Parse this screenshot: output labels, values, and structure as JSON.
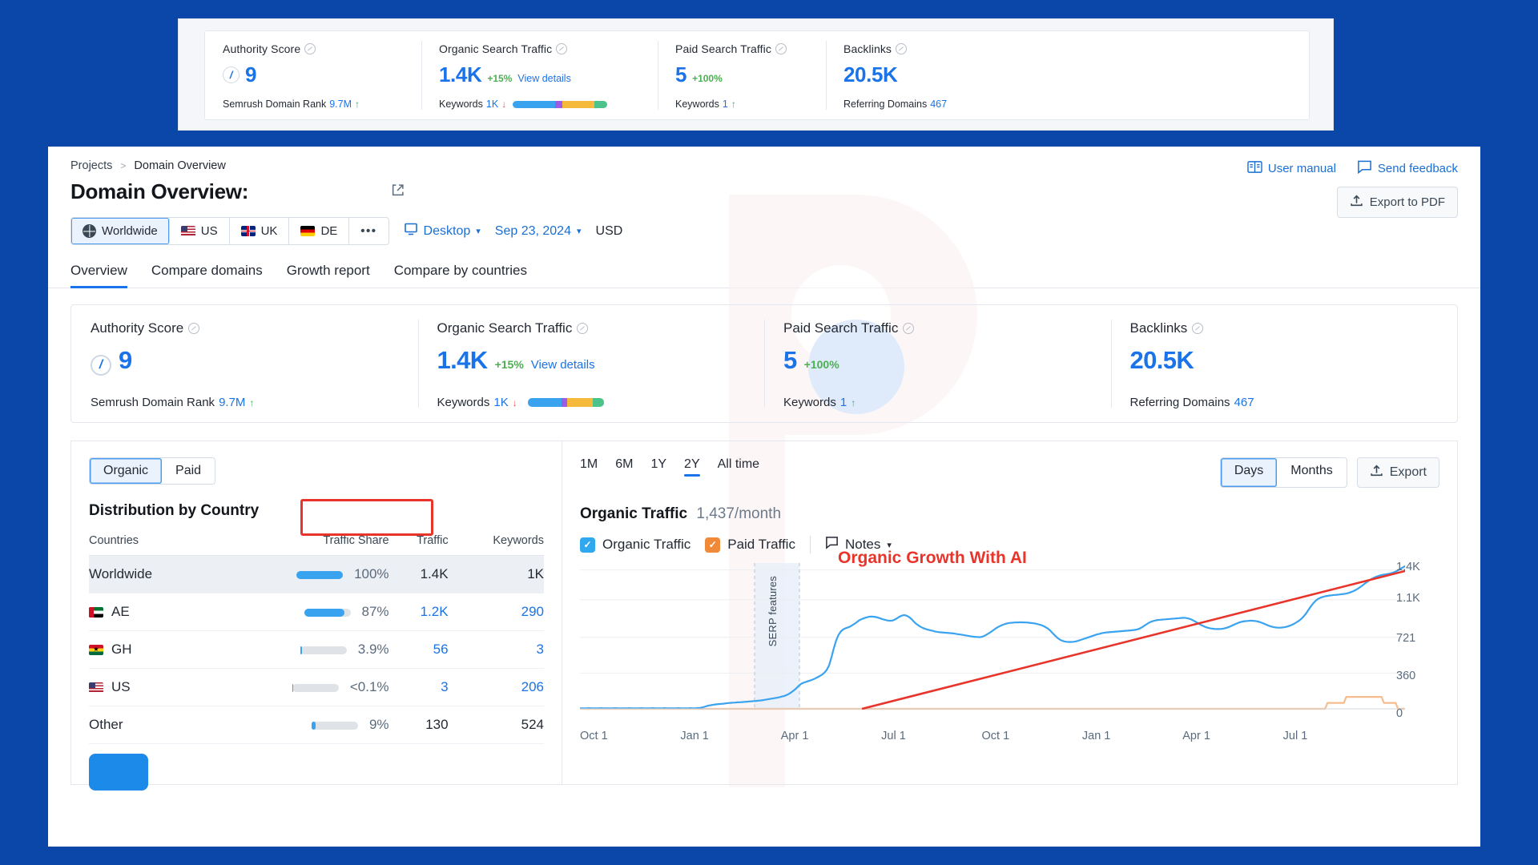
{
  "top_card": {
    "cells": [
      {
        "label": "Authority Score",
        "info_icon": "info-icon",
        "score": "9",
        "score_ring_icon": "authority-ring-icon",
        "sub_label": "Semrush Domain Rank",
        "sub_value": "9.7M",
        "trend": "↑",
        "trend_dir": "up"
      },
      {
        "label": "Organic Search Traffic",
        "info_icon": "info-icon",
        "value": "1.4K",
        "delta": "+15%",
        "link": "View details",
        "sub_label": "Keywords",
        "sub_value": "1K",
        "trend": "↓",
        "trend_dir": "down"
      },
      {
        "label": "Paid Search Traffic",
        "info_icon": "info-icon",
        "value": "5",
        "delta": "+100%",
        "sub_label": "Keywords",
        "sub_value": "1",
        "trend": "↑",
        "trend_dir": "up"
      },
      {
        "label": "Backlinks",
        "info_icon": "info-icon",
        "value": "20.5K",
        "sub_label": "Referring Domains",
        "sub_value": "467"
      }
    ]
  },
  "header": {
    "breadcrumb": {
      "root": "Projects",
      "separator": ">",
      "current": "Domain Overview"
    },
    "title_prefix": "Domain Overview:",
    "external_link_icon": "external-link-icon",
    "user_manual": "User manual",
    "user_manual_icon": "book-icon",
    "send_feedback": "Send feedback",
    "send_feedback_icon": "speech-bubble-icon",
    "export_pdf": "Export to PDF",
    "export_pdf_icon": "upload-icon"
  },
  "filters": {
    "geos": [
      {
        "label": "Worldwide",
        "icon": "globe-icon",
        "active": true
      },
      {
        "label": "US",
        "icon": "flag-us-icon",
        "active": false
      },
      {
        "label": "UK",
        "icon": "flag-uk-icon",
        "active": false
      },
      {
        "label": "DE",
        "icon": "flag-de-icon",
        "active": false
      },
      {
        "label": "•••",
        "icon": "more-icon",
        "active": false
      }
    ],
    "device": "Desktop",
    "device_icon": "monitor-icon",
    "date": "Sep 23, 2024",
    "currency": "USD"
  },
  "tabs": [
    {
      "label": "Overview",
      "active": true
    },
    {
      "label": "Compare domains",
      "active": false
    },
    {
      "label": "Growth report",
      "active": false
    },
    {
      "label": "Compare by countries",
      "active": false
    }
  ],
  "metrics": [
    {
      "label": "Authority Score",
      "info_icon": "info-icon",
      "score": "9",
      "sub_label": "Semrush Domain Rank",
      "sub_value": "9.7M",
      "trend": "↑"
    },
    {
      "label": "Organic Search Traffic",
      "info_icon": "info-icon",
      "value": "1.4K",
      "delta": "+15%",
      "link": "View details",
      "sub_label": "Keywords",
      "sub_value": "1K",
      "trend": "↓"
    },
    {
      "label": "Paid Search Traffic",
      "info_icon": "info-icon",
      "value": "5",
      "delta": "+100%",
      "sub_label": "Keywords",
      "sub_value": "1",
      "trend": "↑"
    },
    {
      "label": "Backlinks",
      "info_icon": "info-icon",
      "value": "20.5K",
      "sub_label": "Referring Domains",
      "sub_value": "467"
    }
  ],
  "left_pane": {
    "segments": [
      {
        "label": "Organic",
        "active": true
      },
      {
        "label": "Paid",
        "active": false
      }
    ],
    "title": "Distribution by Country",
    "columns": [
      "Countries",
      "Traffic Share",
      "Traffic",
      "Keywords"
    ],
    "rows": [
      {
        "country": "Worldwide",
        "flag": null,
        "share_pct": 100,
        "share": "100%",
        "traffic": "1.4K",
        "keywords": "1K",
        "highlight": true,
        "link": false
      },
      {
        "country": "AE",
        "flag": "flag-ae-icon",
        "share_pct": 87,
        "share": "87%",
        "traffic": "1.2K",
        "keywords": "290",
        "highlight": false,
        "link": true
      },
      {
        "country": "GH",
        "flag": "flag-gh-icon",
        "share_pct": 4,
        "share": "3.9%",
        "traffic": "56",
        "keywords": "3",
        "highlight": false,
        "link": true
      },
      {
        "country": "US",
        "flag": "flag-us-icon",
        "share_pct": 0.5,
        "share": "<0.1%",
        "traffic": "3",
        "keywords": "206",
        "highlight": false,
        "link": true
      },
      {
        "country": "Other",
        "flag": null,
        "share_pct": 9,
        "share": "9%",
        "traffic": "130",
        "keywords": "524",
        "highlight": false,
        "link": false
      }
    ]
  },
  "right_pane": {
    "ranges": [
      {
        "label": "1M",
        "active": false
      },
      {
        "label": "6M",
        "active": false
      },
      {
        "label": "1Y",
        "active": false
      },
      {
        "label": "2Y",
        "active": true
      },
      {
        "label": "All time",
        "active": false
      }
    ],
    "granularity": [
      {
        "label": "Days",
        "active": true
      },
      {
        "label": "Months",
        "active": false
      }
    ],
    "export": "Export",
    "export_icon": "upload-icon",
    "headline_label": "Organic Traffic",
    "headline_value": "1,437/month",
    "legend": [
      {
        "label": "Organic Traffic",
        "color": "#2fa8f0",
        "checked": true
      },
      {
        "label": "Paid Traffic",
        "color": "#f08a39",
        "checked": true
      }
    ],
    "notes": "Notes",
    "notes_icon": "flag-note-icon",
    "serp_band_label": "SERP features",
    "annotation": "Organic Growth With AI",
    "annotation_color": "#e8342a"
  },
  "chart_data": {
    "type": "line",
    "title": "Organic Traffic",
    "xlabel": "",
    "ylabel": "",
    "grid": true,
    "legend_position": "top-left",
    "ylim": [
      0,
      1437
    ],
    "yticks": [
      0,
      360,
      721,
      1100,
      1400
    ],
    "ytick_labels": [
      "0",
      "360",
      "721",
      "1.1K",
      "1.4K"
    ],
    "xtick_labels": [
      "Oct 1",
      "Jan 1",
      "Apr 1",
      "Jul 1",
      "Oct 1",
      "Jan 1",
      "Apr 1",
      "Jul 1"
    ],
    "annotations": [
      {
        "text": "Organic Growth With AI",
        "color": "#e8342a",
        "type": "trend-arrow"
      }
    ],
    "series": [
      {
        "name": "Organic Traffic",
        "color": "#3aa3f0",
        "values": [
          5,
          6,
          6,
          5,
          7,
          6,
          6,
          5,
          6,
          7,
          6,
          6,
          5,
          6,
          6,
          7,
          6,
          5,
          6,
          6,
          6,
          7,
          6,
          6,
          5,
          6,
          7,
          6,
          6,
          6,
          5,
          7,
          6,
          6,
          6,
          6,
          7,
          6,
          5,
          6,
          6,
          6,
          7,
          6,
          6,
          6,
          6,
          7,
          6,
          6,
          8,
          10,
          14,
          20,
          28,
          34,
          38,
          42,
          45,
          48,
          50,
          52,
          55,
          58,
          60,
          62,
          63,
          65,
          66,
          68,
          70,
          72,
          74,
          76,
          78,
          80,
          82,
          85,
          88,
          92,
          96,
          100,
          104,
          108,
          112,
          118,
          124,
          130,
          140,
          152,
          168,
          186,
          206,
          230,
          250,
          262,
          270,
          278,
          286,
          295,
          305,
          318,
          330,
          345,
          365,
          392,
          440,
          520,
          610,
          690,
          745,
          780,
          800,
          812,
          820,
          830,
          845,
          860,
          878,
          895,
          905,
          915,
          922,
          928,
          930,
          928,
          924,
          918,
          910,
          902,
          895,
          890,
          888,
          890,
          900,
          915,
          930,
          940,
          945,
          938,
          925,
          905,
          880,
          858,
          840,
          826,
          814,
          805,
          798,
          792,
          786,
          780,
          776,
          772,
          770,
          768,
          766,
          764,
          762,
          760,
          756,
          752,
          748,
          744,
          740,
          736,
          732,
          728,
          726,
          724,
          722,
          726,
          735,
          748,
          762,
          778,
          795,
          812,
          826,
          838,
          848,
          856,
          862,
          866,
          868,
          870,
          871,
          872,
          872,
          871,
          870,
          868,
          865,
          862,
          858,
          852,
          845,
          836,
          824,
          810,
          790,
          765,
          740,
          718,
          700,
          688,
          680,
          676,
          674,
          674,
          676,
          680,
          686,
          694,
          702,
          710,
          718,
          726,
          734,
          742,
          750,
          756,
          762,
          766,
          770,
          772,
          774,
          776,
          778,
          780,
          782,
          784,
          786,
          788,
          790,
          792,
          795,
          800,
          808,
          820,
          836,
          852,
          866,
          878,
          886,
          892,
          896,
          898,
          900,
          902,
          904,
          906,
          908,
          910,
          912,
          914,
          916,
          918,
          915,
          910,
          902,
          890,
          876,
          862,
          848,
          836,
          826,
          818,
          812,
          808,
          805,
          804,
          804,
          806,
          810,
          816,
          824,
          834,
          845,
          856,
          866,
          874,
          880,
          884,
          886,
          888,
          888,
          886,
          882,
          876,
          868,
          858,
          848,
          838,
          830,
          824,
          820,
          818,
          818,
          820,
          824,
          830,
          838,
          848,
          860,
          874,
          890,
          910,
          935,
          965,
          1000,
          1035,
          1065,
          1090,
          1108,
          1120,
          1128,
          1134,
          1138,
          1142,
          1145,
          1148,
          1150,
          1152,
          1155,
          1158,
          1162,
          1168,
          1176,
          1186,
          1198,
          1212,
          1228,
          1246,
          1264,
          1282,
          1298,
          1312,
          1324,
          1334,
          1342,
          1348,
          1352,
          1356,
          1360,
          1366,
          1374,
          1384,
          1396,
          1410,
          1425,
          1437
        ]
      },
      {
        "name": "Paid Traffic",
        "color": "#f5bd8e",
        "values": [
          0,
          0,
          0,
          0,
          0,
          0,
          0,
          0,
          0,
          0,
          0,
          0,
          0,
          0,
          0,
          0,
          0,
          0,
          0,
          0,
          0,
          0,
          0,
          0,
          0,
          0,
          0,
          0,
          0,
          0,
          0,
          0,
          0,
          0,
          0,
          0,
          0,
          0,
          0,
          0,
          0,
          0,
          0,
          0,
          0,
          0,
          0,
          0,
          0,
          0,
          0,
          0,
          0,
          0,
          0,
          0,
          0,
          0,
          0,
          0,
          0,
          0,
          0,
          0,
          0,
          0,
          0,
          0,
          0,
          0,
          0,
          0,
          0,
          0,
          0,
          0,
          0,
          0,
          0,
          0,
          0,
          0,
          0,
          0,
          0,
          0,
          0,
          0,
          0,
          0,
          0,
          0,
          0,
          0,
          0,
          0,
          0,
          0,
          0,
          0,
          0,
          0,
          0,
          0,
          0,
          0,
          0,
          0,
          0,
          0,
          0,
          0,
          0,
          0,
          0,
          0,
          0,
          0,
          0,
          0,
          0,
          0,
          0,
          0,
          0,
          0,
          0,
          0,
          0,
          0,
          0,
          0,
          0,
          0,
          0,
          0,
          0,
          0,
          0,
          0,
          0,
          0,
          0,
          0,
          0,
          0,
          0,
          0,
          0,
          0,
          0,
          0,
          0,
          0,
          0,
          0,
          0,
          0,
          0,
          0,
          0,
          0,
          0,
          0,
          0,
          0,
          0,
          0,
          0,
          0,
          0,
          0,
          0,
          0,
          0,
          0,
          0,
          0,
          0,
          0,
          0,
          0,
          0,
          0,
          0,
          0,
          0,
          0,
          0,
          0,
          0,
          0,
          0,
          0,
          0,
          0,
          0,
          0,
          0,
          0,
          0,
          0,
          0,
          0,
          0,
          0,
          0,
          0,
          0,
          0,
          0,
          0,
          0,
          0,
          0,
          0,
          0,
          0,
          0,
          0,
          0,
          0,
          0,
          0,
          0,
          0,
          0,
          0,
          0,
          0,
          0,
          0,
          0,
          0,
          0,
          0,
          0,
          0,
          0,
          0,
          0,
          0,
          0,
          0,
          0,
          0,
          0,
          0,
          0,
          0,
          0,
          0,
          0,
          0,
          0,
          0,
          0,
          0,
          0,
          0,
          0,
          0,
          0,
          0,
          0,
          0,
          0,
          0,
          0,
          0,
          0,
          0,
          0,
          0,
          0,
          0,
          0,
          0,
          0,
          0,
          0,
          0,
          0,
          0,
          0,
          0,
          0,
          0,
          0,
          0,
          0,
          0,
          0,
          0,
          0,
          0,
          0,
          0,
          0,
          0,
          0,
          0,
          0,
          0,
          0,
          0,
          0,
          0,
          0,
          0,
          0,
          0,
          0,
          0,
          0,
          0,
          0,
          0,
          60,
          60,
          60,
          60,
          60,
          60,
          60,
          60,
          120,
          120,
          120,
          120,
          120,
          120,
          120,
          120,
          120,
          120,
          120,
          120,
          120,
          120,
          120,
          120,
          60,
          60,
          60,
          60,
          60,
          60,
          0,
          0,
          0,
          0,
          0,
          0,
          0,
          0,
          0,
          0,
          0,
          0,
          0,
          0,
          0,
          0,
          0,
          0,
          0,
          0,
          0,
          0,
          0,
          0,
          0,
          0,
          0,
          0,
          0,
          0,
          0,
          0,
          0,
          0,
          0,
          0,
          0,
          0,
          0,
          0,
          0,
          0,
          0,
          0,
          0,
          0,
          0,
          0,
          0,
          0,
          0,
          0,
          0,
          0,
          0,
          0,
          0,
          0,
          0,
          0,
          0,
          0,
          0,
          0,
          0,
          0,
          0,
          0,
          0,
          0,
          0,
          0,
          0,
          0,
          0,
          0,
          0,
          0,
          0,
          0,
          0,
          0,
          0,
          0,
          0,
          0,
          0,
          0,
          0,
          0,
          0,
          0,
          0,
          0,
          0,
          0,
          0,
          0,
          0,
          0,
          0,
          0,
          0,
          0,
          0,
          0,
          0,
          0,
          0,
          0,
          0,
          0,
          0,
          0,
          0,
          0,
          0,
          0,
          0,
          0,
          0,
          0,
          0,
          0,
          0,
          0,
          0,
          0,
          0,
          0,
          0,
          0,
          0,
          0,
          0,
          0,
          0,
          0,
          0,
          0,
          0,
          0,
          0,
          0,
          0,
          0,
          0,
          0,
          0,
          0,
          0,
          0,
          0,
          0,
          0,
          0,
          0,
          0,
          0,
          0,
          0,
          0,
          0,
          0,
          0,
          0,
          0,
          0,
          0,
          0,
          0,
          0
        ]
      }
    ],
    "trend_arrow": {
      "from_index": 120,
      "from_value": 0,
      "to_index": 371,
      "to_value": 1437
    }
  }
}
